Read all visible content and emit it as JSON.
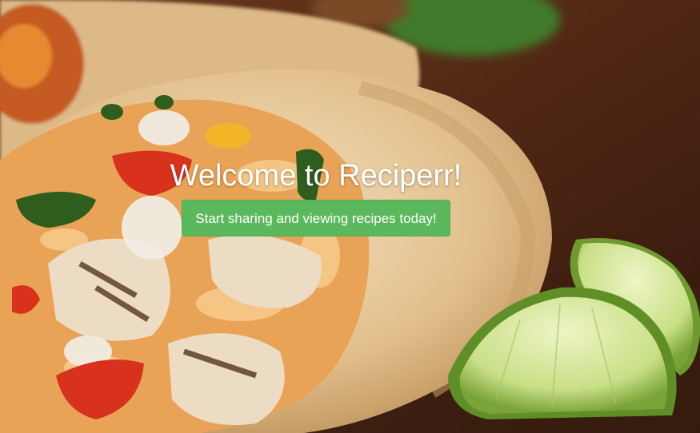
{
  "hero": {
    "title": "Welcome to Reciperr!",
    "cta_label": "Start sharing and viewing recipes today!",
    "background_image": "burrito-with-lime-wedges-photo"
  },
  "colors": {
    "cta_background": "#5cb85c",
    "cta_border": "#4cae4c",
    "title_text": "#ffffff"
  }
}
